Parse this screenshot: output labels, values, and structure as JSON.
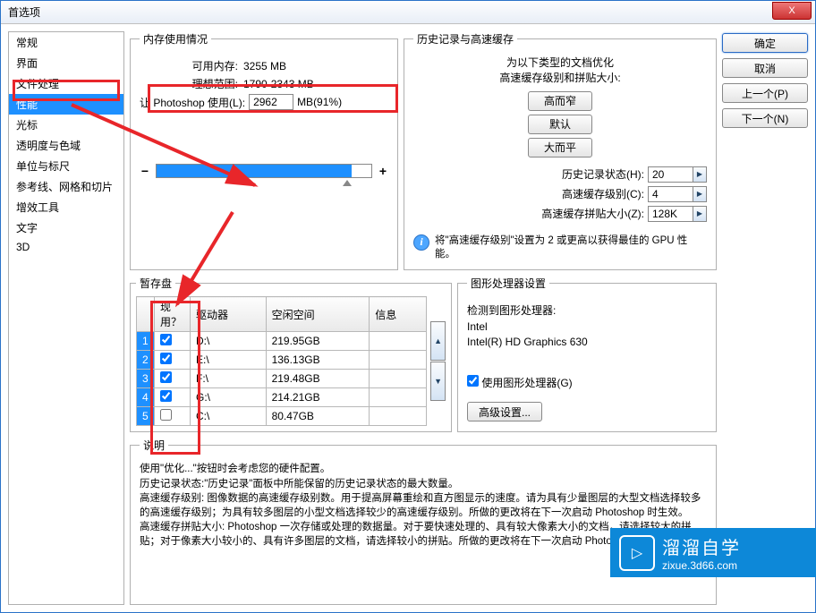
{
  "window": {
    "title": "首选项"
  },
  "sidebar": {
    "items": [
      {
        "label": "常规"
      },
      {
        "label": "界面"
      },
      {
        "label": "文件处理"
      },
      {
        "label": "性能",
        "selected": true
      },
      {
        "label": "光标"
      },
      {
        "label": "透明度与色域"
      },
      {
        "label": "单位与标尺"
      },
      {
        "label": "参考线、网格和切片"
      },
      {
        "label": "增效工具"
      },
      {
        "label": "文字"
      },
      {
        "label": "3D"
      }
    ]
  },
  "memory": {
    "legend": "内存使用情况",
    "avail_label": "可用内存:",
    "avail_value": "3255 MB",
    "ideal_label": "理想范围:",
    "ideal_value": "1790-2343 MB",
    "ps_use_label": "让 Photoshop 使用(L):",
    "ps_use_value": "2962",
    "ps_use_suffix": "MB(91%)"
  },
  "history": {
    "legend": "历史记录与高速缓存",
    "hint_line1": "为以下类型的文档优化",
    "hint_line2": "高速缓存级别和拼贴大小:",
    "btn_tall": "高而窄",
    "btn_default": "默认",
    "btn_flat": "大而平",
    "states_label": "历史记录状态(H):",
    "states_value": "20",
    "levels_label": "高速缓存级别(C):",
    "levels_value": "4",
    "tile_label": "高速缓存拼贴大小(Z):",
    "tile_value": "128K",
    "tip": "将\"高速缓存级别\"设置为 2 或更高以获得最佳的 GPU 性能。"
  },
  "scratch": {
    "legend": "暂存盘",
    "col_active": "现用？",
    "col_drive": "驱动器",
    "col_free": "空闲空间",
    "col_info": "信息",
    "rows": [
      {
        "n": "1",
        "active": true,
        "drive": "D:\\",
        "free": "219.95GB",
        "info": ""
      },
      {
        "n": "2",
        "active": true,
        "drive": "E:\\",
        "free": "136.13GB",
        "info": ""
      },
      {
        "n": "3",
        "active": true,
        "drive": "F:\\",
        "free": "219.48GB",
        "info": ""
      },
      {
        "n": "4",
        "active": true,
        "drive": "G:\\",
        "free": "214.21GB",
        "info": ""
      },
      {
        "n": "5",
        "active": false,
        "drive": "C:\\",
        "free": "80.47GB",
        "info": ""
      }
    ]
  },
  "gpu": {
    "legend": "图形处理器设置",
    "detect_label": "检测到图形处理器:",
    "vendor": "Intel",
    "model": "Intel(R) HD Graphics 630",
    "use_gpu_label": "使用图形处理器(G)",
    "use_gpu_checked": true,
    "advanced_btn": "高级设置..."
  },
  "desc": {
    "legend": "说明",
    "text": "使用\"优化...\"按钮时会考虑您的硬件配置。\n历史记录状态:\"历史记录\"面板中所能保留的历史记录状态的最大数量。\n高速缓存级别: 图像数据的高速缓存级别数。用于提高屏幕重绘和直方图显示的速度。请为具有少量图层的大型文档选择较多的高速缓存级别；为具有较多图层的小型文档选择较少的高速缓存级别。所做的更改将在下一次启动 Photoshop 时生效。\n高速缓存拼贴大小: Photoshop 一次存储或处理的数据量。对于要快速处理的、具有较大像素大小的文档，请选择较大的拼贴；对于像素大小较小的、具有许多图层的文档，请选择较小的拼贴。所做的更改将在下一次启动 Photoshop 时生效。"
  },
  "buttons": {
    "ok": "确定",
    "cancel": "取消",
    "prev": "上一个(P)",
    "next": "下一个(N)"
  },
  "close_icon": "X",
  "watermark": {
    "title": "溜溜自学",
    "url": "zixue.3d66.com"
  }
}
